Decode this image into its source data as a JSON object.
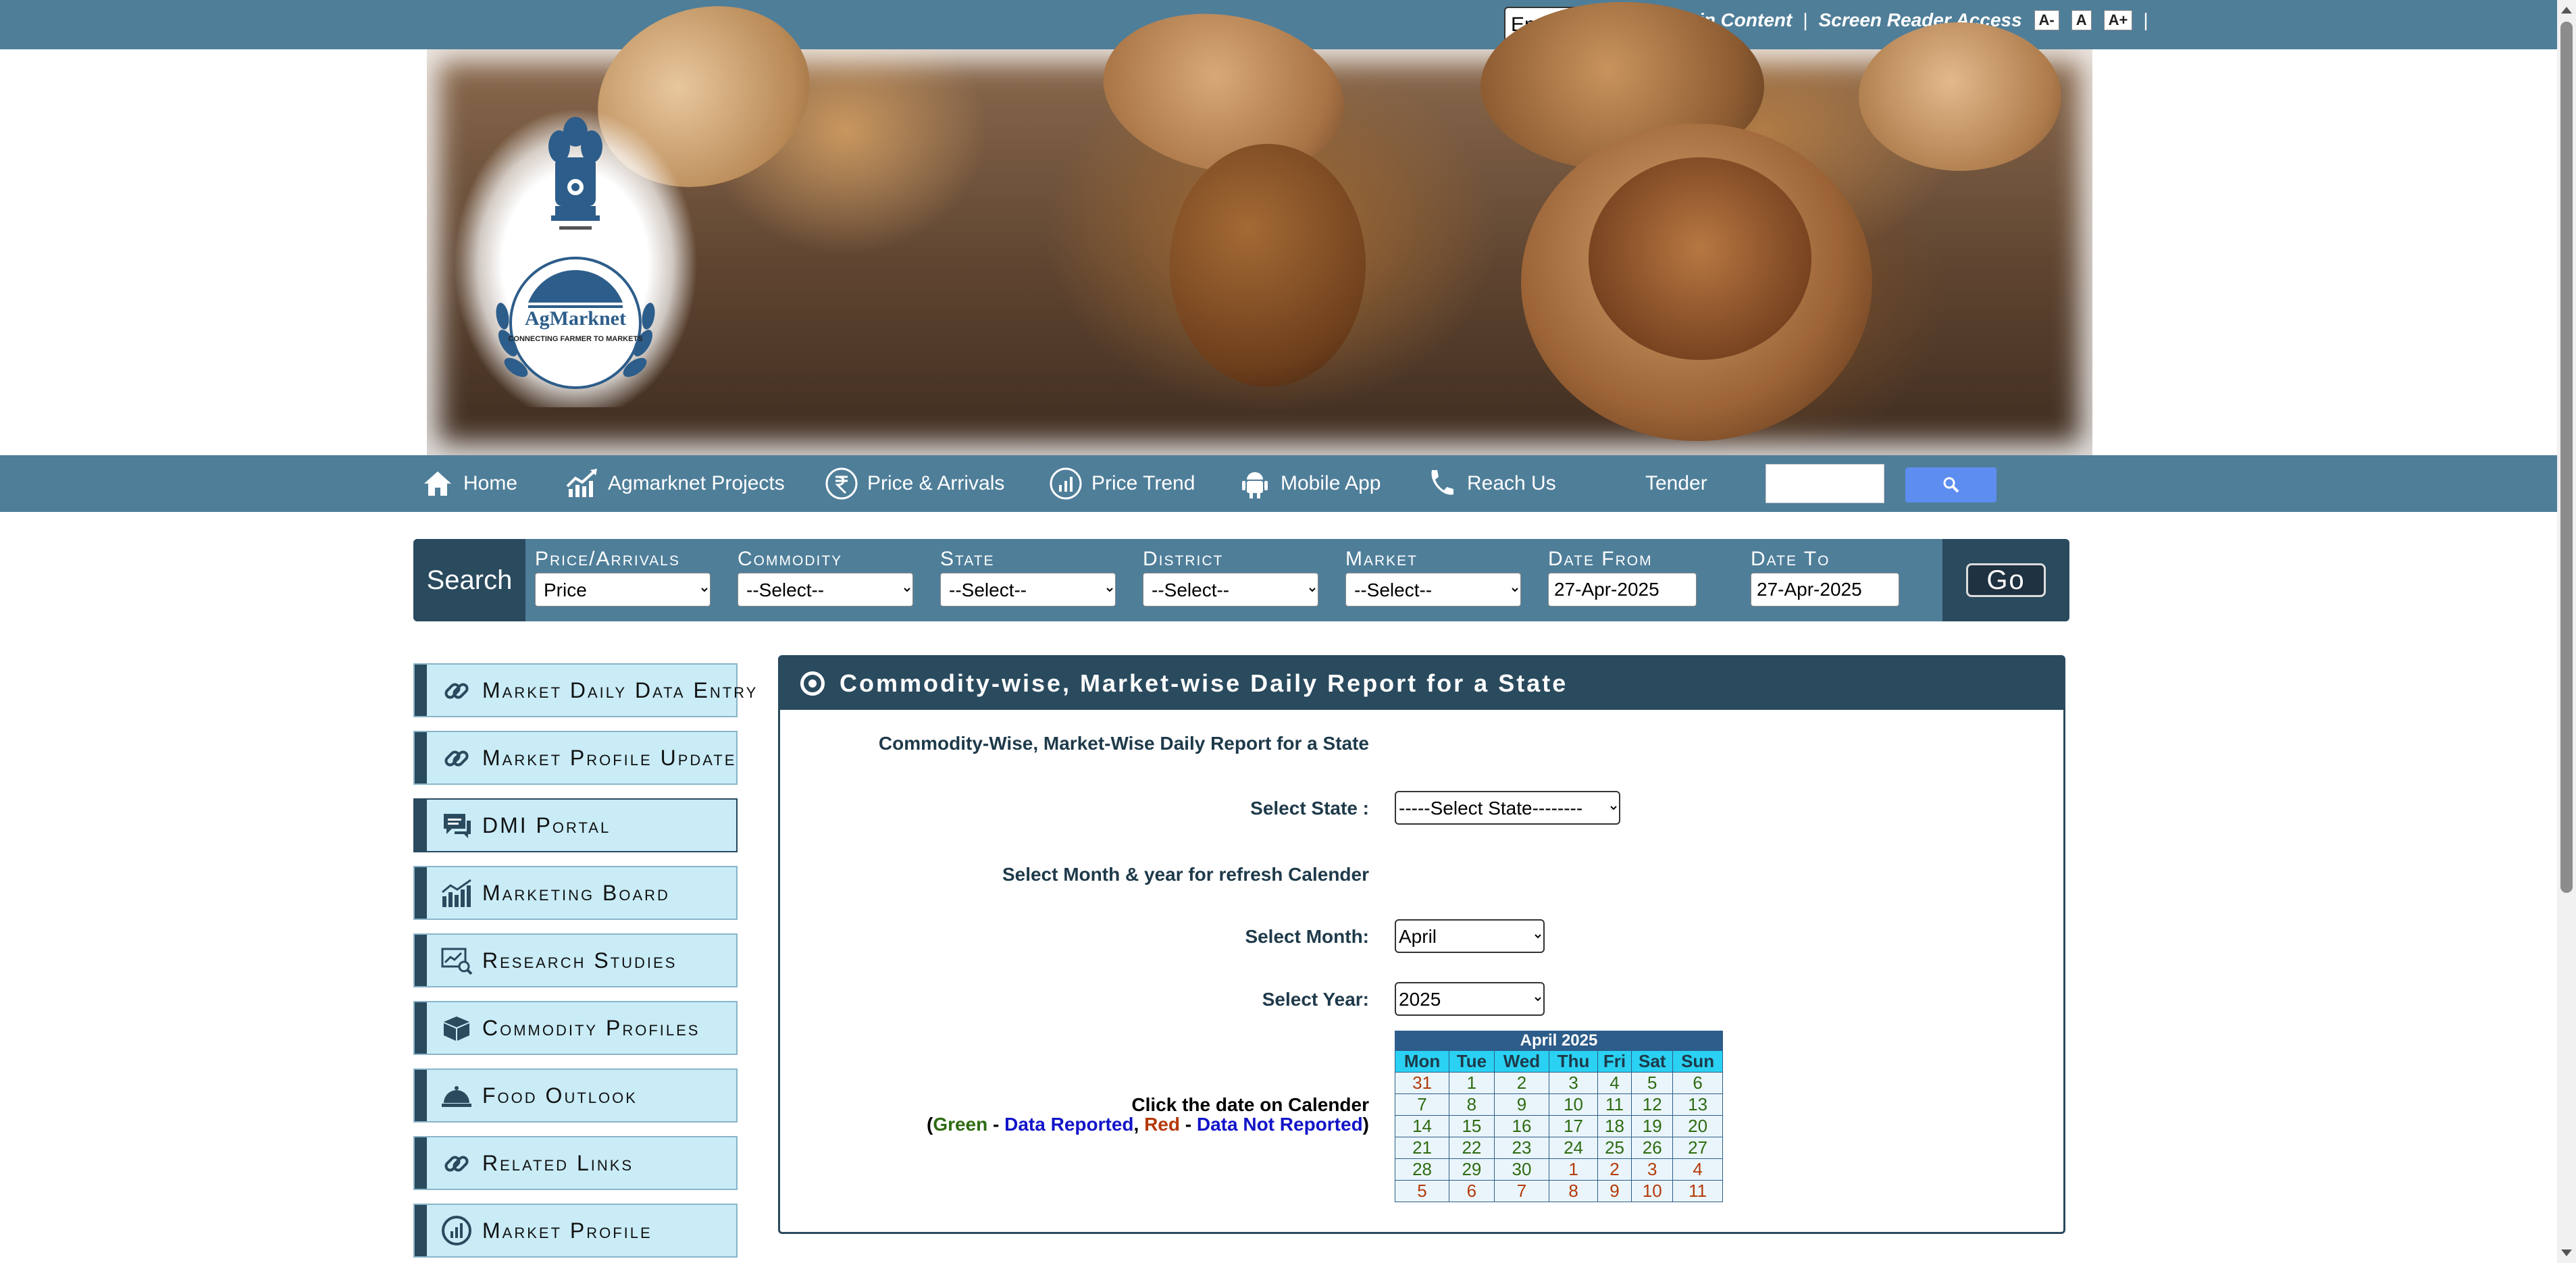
{
  "topbar": {
    "language": "English",
    "skip_link": "skip to Main Content",
    "separator": "|",
    "screen_reader": "Screen Reader Access",
    "font_small": "A-",
    "font_normal": "A",
    "font_large": "A+",
    "trailing_separator": "|"
  },
  "banner": {
    "logo_text": "AgMarknet",
    "logo_tagline": "CONNECTING FARMER TO MARKETS"
  },
  "nav": {
    "items": [
      {
        "label": "Home",
        "icon": "home-icon"
      },
      {
        "label": "Agmarknet Projects",
        "icon": "chart-trend-icon"
      },
      {
        "label": "Price & Arrivals",
        "icon": "rupee-icon"
      },
      {
        "label": "Price Trend",
        "icon": "gauge-icon"
      },
      {
        "label": "Mobile App",
        "icon": "android-icon"
      },
      {
        "label": "Reach Us",
        "icon": "phone-icon"
      },
      {
        "label": "Tender",
        "icon": ""
      }
    ],
    "search_placeholder": "",
    "search_icon": "search-icon"
  },
  "search": {
    "label": "Search",
    "fields": [
      {
        "label": "Price/Arrivals",
        "value": "Price"
      },
      {
        "label": "Commodity",
        "value": "--Select--"
      },
      {
        "label": "State",
        "value": "--Select--"
      },
      {
        "label": "District",
        "value": "--Select--"
      },
      {
        "label": "Market",
        "value": "--Select--"
      },
      {
        "label": "Date From",
        "value": "27-Apr-2025"
      },
      {
        "label": "Date To",
        "value": "27-Apr-2025"
      }
    ],
    "go": "Go"
  },
  "sidebar": {
    "items": [
      {
        "label": "Market Daily Data Entry",
        "icon": "link-icon"
      },
      {
        "label": "Market Profile Update",
        "icon": "link-icon"
      },
      {
        "label": "DMI Portal",
        "icon": "chat-icon"
      },
      {
        "label": "Marketing Board",
        "icon": "bar-chart-icon"
      },
      {
        "label": "Research Studies",
        "icon": "research-icon"
      },
      {
        "label": "Commodity Profiles",
        "icon": "box-icon"
      },
      {
        "label": "Food Outlook",
        "icon": "cloche-icon"
      },
      {
        "label": "Related Links",
        "icon": "link-icon"
      },
      {
        "label": "Market Profile",
        "icon": "market-icon"
      }
    ]
  },
  "panel": {
    "title": "Commodity-wise, Market-wise Daily Report for a State",
    "subtitle": "Commodity-Wise, Market-Wise Daily Report for a State",
    "state_label": "Select State :",
    "state_value": "-----Select State--------",
    "refresh_label": "Select Month & year for refresh Calender",
    "month_label": "Select Month:",
    "month_value": "April",
    "year_label": "Select Year:",
    "year_value": "2025",
    "legend": {
      "line1": "Click the date on Calender",
      "open": "(",
      "green": "Green",
      "dash1": " - ",
      "reported": "Data Reported",
      "comma": ", ",
      "red": "Red",
      "dash2": " - ",
      "not_reported": "Data Not Reported",
      "close": ")"
    }
  },
  "calendar": {
    "title": "April 2025",
    "days": [
      "Mon",
      "Tue",
      "Wed",
      "Thu",
      "Fri",
      "Sat",
      "Sun"
    ],
    "weeks": [
      [
        {
          "d": "31",
          "s": "red"
        },
        {
          "d": "1",
          "s": "green"
        },
        {
          "d": "2",
          "s": "green"
        },
        {
          "d": "3",
          "s": "green"
        },
        {
          "d": "4",
          "s": "green"
        },
        {
          "d": "5",
          "s": "green"
        },
        {
          "d": "6",
          "s": "green"
        }
      ],
      [
        {
          "d": "7",
          "s": "green"
        },
        {
          "d": "8",
          "s": "green"
        },
        {
          "d": "9",
          "s": "green"
        },
        {
          "d": "10",
          "s": "green"
        },
        {
          "d": "11",
          "s": "green"
        },
        {
          "d": "12",
          "s": "green"
        },
        {
          "d": "13",
          "s": "green"
        }
      ],
      [
        {
          "d": "14",
          "s": "green"
        },
        {
          "d": "15",
          "s": "green"
        },
        {
          "d": "16",
          "s": "green"
        },
        {
          "d": "17",
          "s": "green"
        },
        {
          "d": "18",
          "s": "green"
        },
        {
          "d": "19",
          "s": "green"
        },
        {
          "d": "20",
          "s": "green"
        }
      ],
      [
        {
          "d": "21",
          "s": "green"
        },
        {
          "d": "22",
          "s": "green"
        },
        {
          "d": "23",
          "s": "green"
        },
        {
          "d": "24",
          "s": "green"
        },
        {
          "d": "25",
          "s": "green"
        },
        {
          "d": "26",
          "s": "green"
        },
        {
          "d": "27",
          "s": "green"
        }
      ],
      [
        {
          "d": "28",
          "s": "green"
        },
        {
          "d": "29",
          "s": "green"
        },
        {
          "d": "30",
          "s": "green"
        },
        {
          "d": "1",
          "s": "red"
        },
        {
          "d": "2",
          "s": "red"
        },
        {
          "d": "3",
          "s": "red"
        },
        {
          "d": "4",
          "s": "red"
        }
      ],
      [
        {
          "d": "5",
          "s": "red"
        },
        {
          "d": "6",
          "s": "red"
        },
        {
          "d": "7",
          "s": "red"
        },
        {
          "d": "8",
          "s": "red"
        },
        {
          "d": "9",
          "s": "red"
        },
        {
          "d": "10",
          "s": "red"
        },
        {
          "d": "11",
          "s": "red"
        }
      ]
    ]
  },
  "colors": {
    "bar": "#4f7e99",
    "dark": "#2a4a5e",
    "sidebar_bg": "#c9ecf7",
    "reported": "#2e6b12",
    "not_reported": "#b43a0a",
    "legend_blue": "#1214c8"
  }
}
